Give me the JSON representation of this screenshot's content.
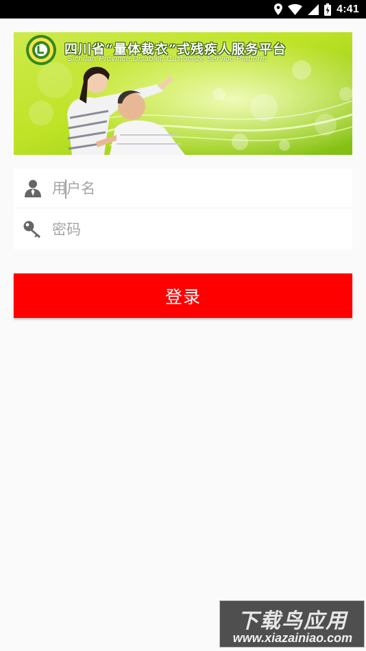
{
  "status_bar": {
    "time": "4:41",
    "icons": [
      "location-icon",
      "wifi-icon",
      "cellular-signal-icon",
      "battery-charging-icon"
    ]
  },
  "banner": {
    "title": "四川省“量体裁衣”式残疾人服务平台",
    "subtitle": "Sichuan Province Disabled Customize Service Platform",
    "logo": "disability-logo-icon"
  },
  "login_form": {
    "username_placeholder": "用户名",
    "username_value": "",
    "password_placeholder": "密码",
    "password_value": "",
    "username_icon": "user-icon",
    "password_icon": "key-icon"
  },
  "login_button": {
    "label": "登录",
    "color": "#ff0000"
  },
  "watermark": {
    "title": "下载鸟应用",
    "url": "www.xiazainiao.com"
  }
}
